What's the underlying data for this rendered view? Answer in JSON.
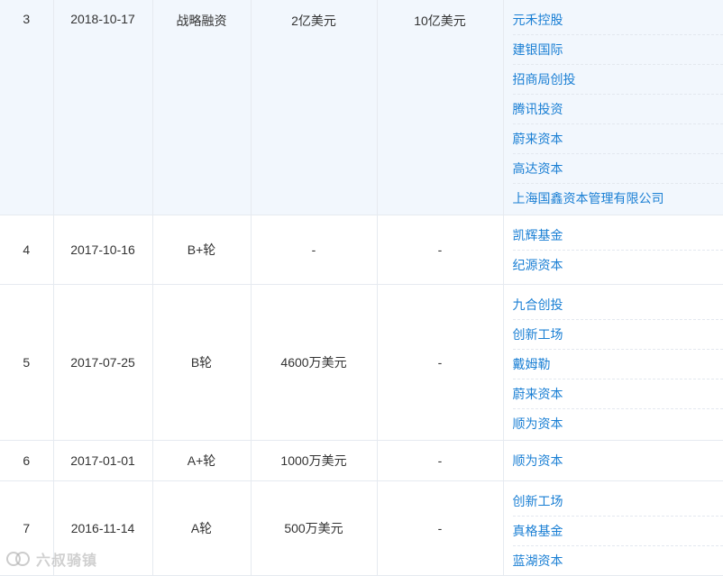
{
  "rows": [
    {
      "index": "3",
      "date": "2018-10-17",
      "round": "战略融资",
      "amount": "2亿美元",
      "valuation": "10亿美元",
      "investors": [
        "元禾控股",
        "建银国际",
        "招商局创投",
        "腾讯投资",
        "蔚来资本",
        "高达资本",
        "上海国鑫资本管理有限公司"
      ]
    },
    {
      "index": "4",
      "date": "2017-10-16",
      "round": "B+轮",
      "amount": "-",
      "valuation": "-",
      "investors": [
        "凯辉基金",
        "纪源资本"
      ]
    },
    {
      "index": "5",
      "date": "2017-07-25",
      "round": "B轮",
      "amount": "4600万美元",
      "valuation": "-",
      "investors": [
        "九合创投",
        "创新工场",
        "戴姆勒",
        "蔚来资本",
        "顺为资本"
      ]
    },
    {
      "index": "6",
      "date": "2017-01-01",
      "round": "A+轮",
      "amount": "1000万美元",
      "valuation": "-",
      "investors": [
        "顺为资本"
      ]
    },
    {
      "index": "7",
      "date": "2016-11-14",
      "round": "A轮",
      "amount": "500万美元",
      "valuation": "-",
      "investors": [
        "创新工场",
        "真格基金",
        "蓝湖资本"
      ]
    }
  ],
  "watermark": {
    "text": "六叔骑镇",
    "icon": "company-logo-icon"
  },
  "colors": {
    "link": "#1a7fd4",
    "highlight_row": "#f2f7fd",
    "border": "#e6eaf0"
  }
}
